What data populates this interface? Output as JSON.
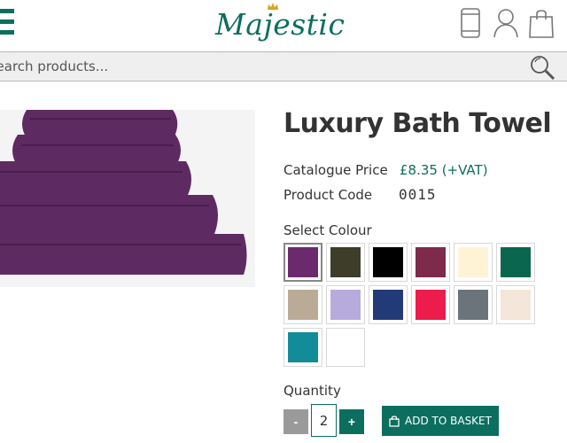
{
  "header": {
    "logo_text": "Majestic",
    "icons": [
      "menu-icon",
      "mobile-phone-icon",
      "user-icon",
      "shopping-bag-icon"
    ],
    "brand_color": "#0c6e5f"
  },
  "search": {
    "placeholder": "Search products...",
    "icon": "search-icon"
  },
  "product": {
    "title": "Luxury Bath Towel",
    "price_label": "Catalogue Price",
    "price_value": "£8.35 (+VAT)",
    "code_label": "Product Code",
    "code_value": "0015",
    "colour_label": "Select Colour",
    "colours": [
      {
        "hex": "#6b2a6e",
        "selected": true
      },
      {
        "hex": "#3d3d2a",
        "selected": false
      },
      {
        "hex": "#000000",
        "selected": false
      },
      {
        "hex": "#7e2a4a",
        "selected": false
      },
      {
        "hex": "#fff3d6",
        "selected": false
      },
      {
        "hex": "#0b6650",
        "selected": false
      },
      {
        "hex": "#b9ab96",
        "selected": false
      },
      {
        "hex": "#b7abde",
        "selected": false
      },
      {
        "hex": "#223a78",
        "selected": false
      },
      {
        "hex": "#ec1c4c",
        "selected": false
      },
      {
        "hex": "#6c747b",
        "selected": false
      },
      {
        "hex": "#f4e6d8",
        "selected": false
      },
      {
        "hex": "#128c98",
        "selected": false
      },
      {
        "hex": "#ffffff",
        "selected": false
      }
    ],
    "quantity_label": "Quantity",
    "quantity_value": "2",
    "minus_label": "-",
    "plus_label": "+",
    "add_to_basket_label": "ADD TO BASKET",
    "towel_color": "#5e2a62"
  }
}
